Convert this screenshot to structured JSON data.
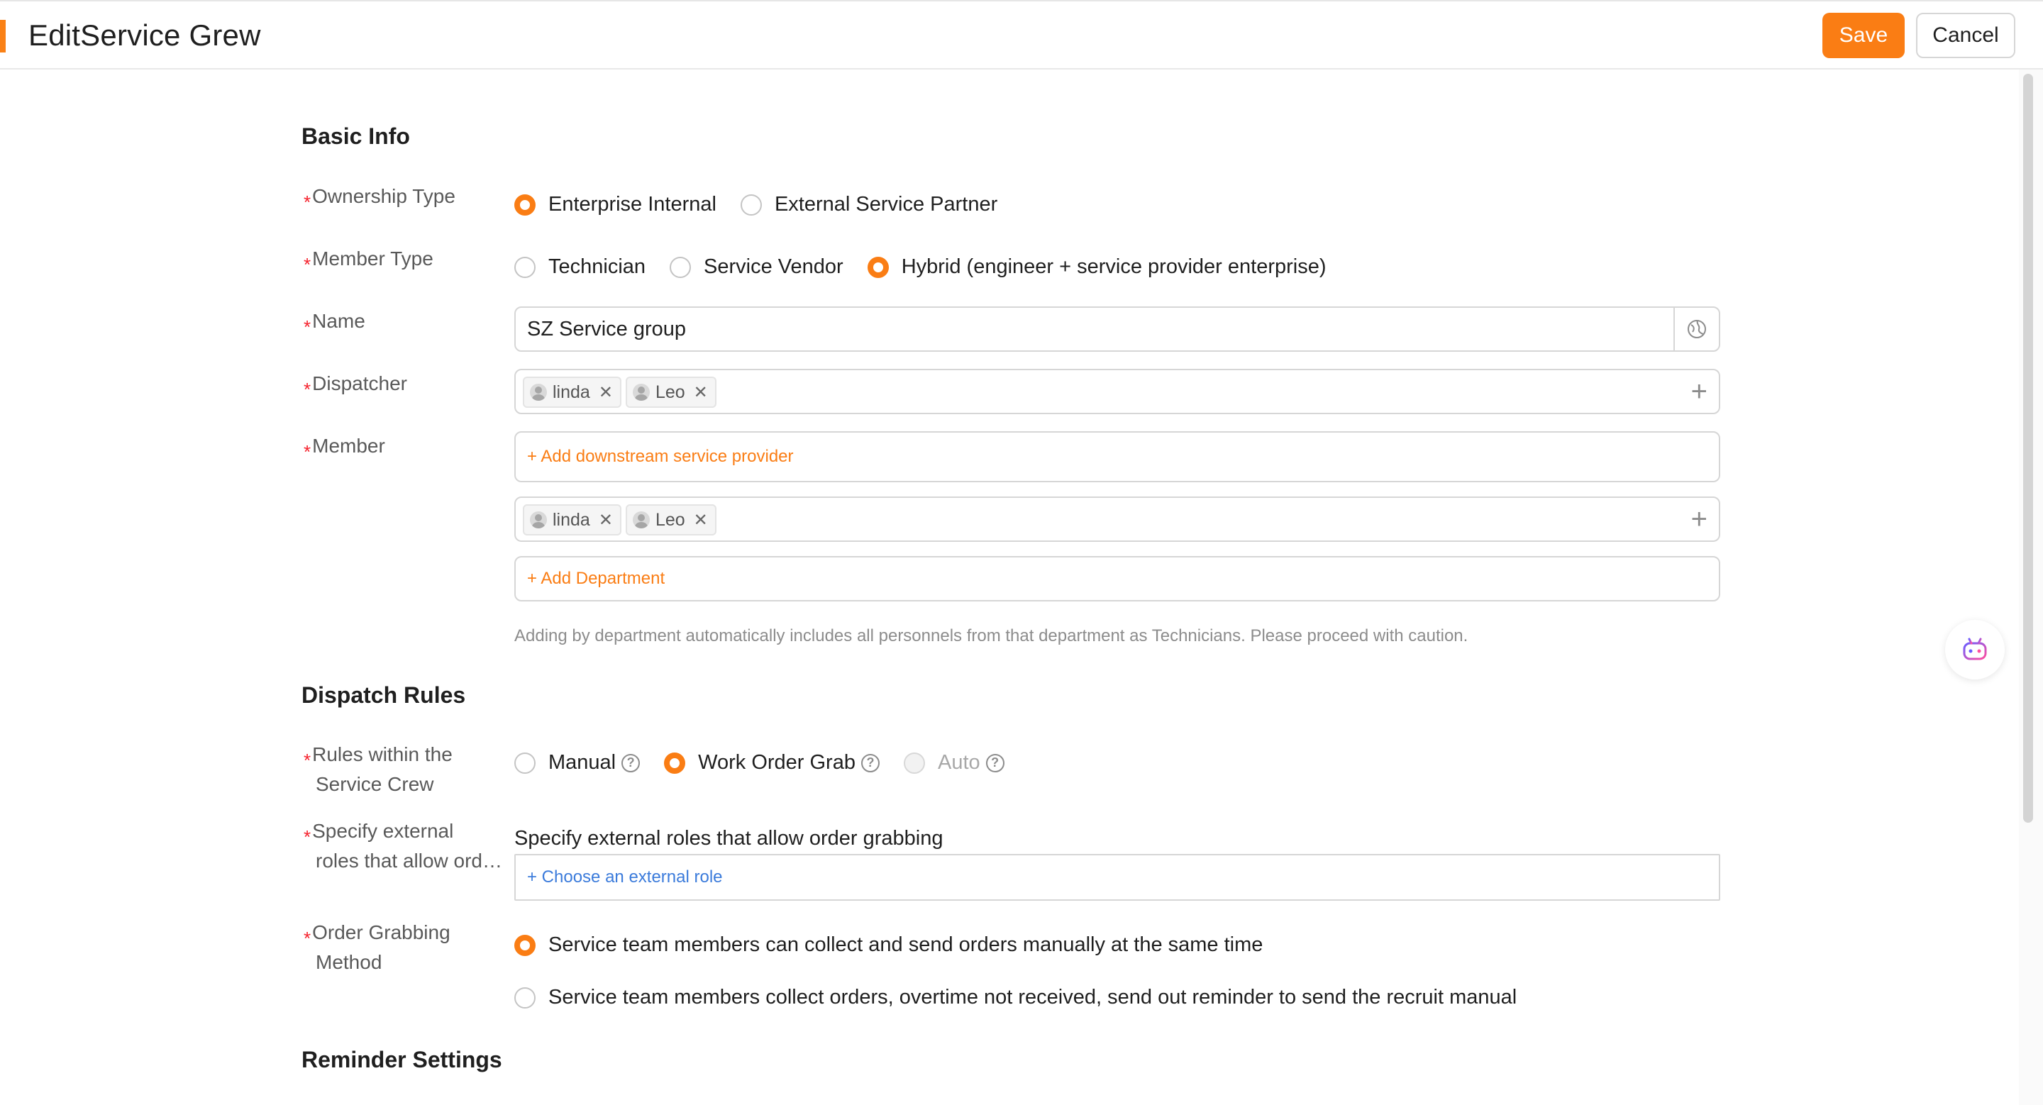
{
  "header": {
    "title": "EditService Grew",
    "save_label": "Save",
    "cancel_label": "Cancel"
  },
  "basic_info": {
    "section_title": "Basic Info",
    "ownership": {
      "label": "Ownership Type",
      "options": [
        "Enterprise Internal",
        "External Service Partner"
      ],
      "selected": "Enterprise Internal"
    },
    "member_type": {
      "label": "Member Type",
      "options": [
        "Technician",
        "Service Vendor",
        "Hybrid (engineer + service provider enterprise)"
      ],
      "selected": "Hybrid (engineer + service provider enterprise)"
    },
    "name": {
      "label": "Name",
      "value": "SZ Service group"
    },
    "dispatcher": {
      "label": "Dispatcher",
      "tags": [
        "linda",
        "Leo"
      ]
    },
    "member": {
      "label": "Member",
      "add_provider": "+ Add downstream service provider",
      "tags": [
        "linda",
        "Leo"
      ],
      "add_department": "+ Add Department",
      "hint": "Adding by department automatically includes all personnels from that department as Technicians. Please proceed with caution."
    }
  },
  "dispatch_rules": {
    "section_title": "Dispatch Rules",
    "rules": {
      "label_line1": "Rules within the",
      "label_line2": "Service Crew",
      "options": [
        "Manual",
        "Work Order Grab",
        "Auto"
      ],
      "selected": "Work Order Grab",
      "disabled": [
        "Auto"
      ]
    },
    "external_roles": {
      "label_line1": "Specify external",
      "label_line2": "roles that allow ord…",
      "description": "Specify external roles that allow order grabbing",
      "choose": "+ Choose an external role"
    },
    "grab_method": {
      "label_line1": "Order Grabbing",
      "label_line2": "Method",
      "options": [
        "Service team members can collect and send orders manually at the same time",
        "Service team members collect orders, overtime not received, send out reminder to send the recruit manual"
      ],
      "selected": "Service team members can collect and send orders manually at the same time"
    }
  },
  "reminder": {
    "section_title": "Reminder Settings"
  },
  "colors": {
    "accent": "#fa7d14",
    "required": "#f5222d",
    "link_blue": "#3b7bdb"
  }
}
